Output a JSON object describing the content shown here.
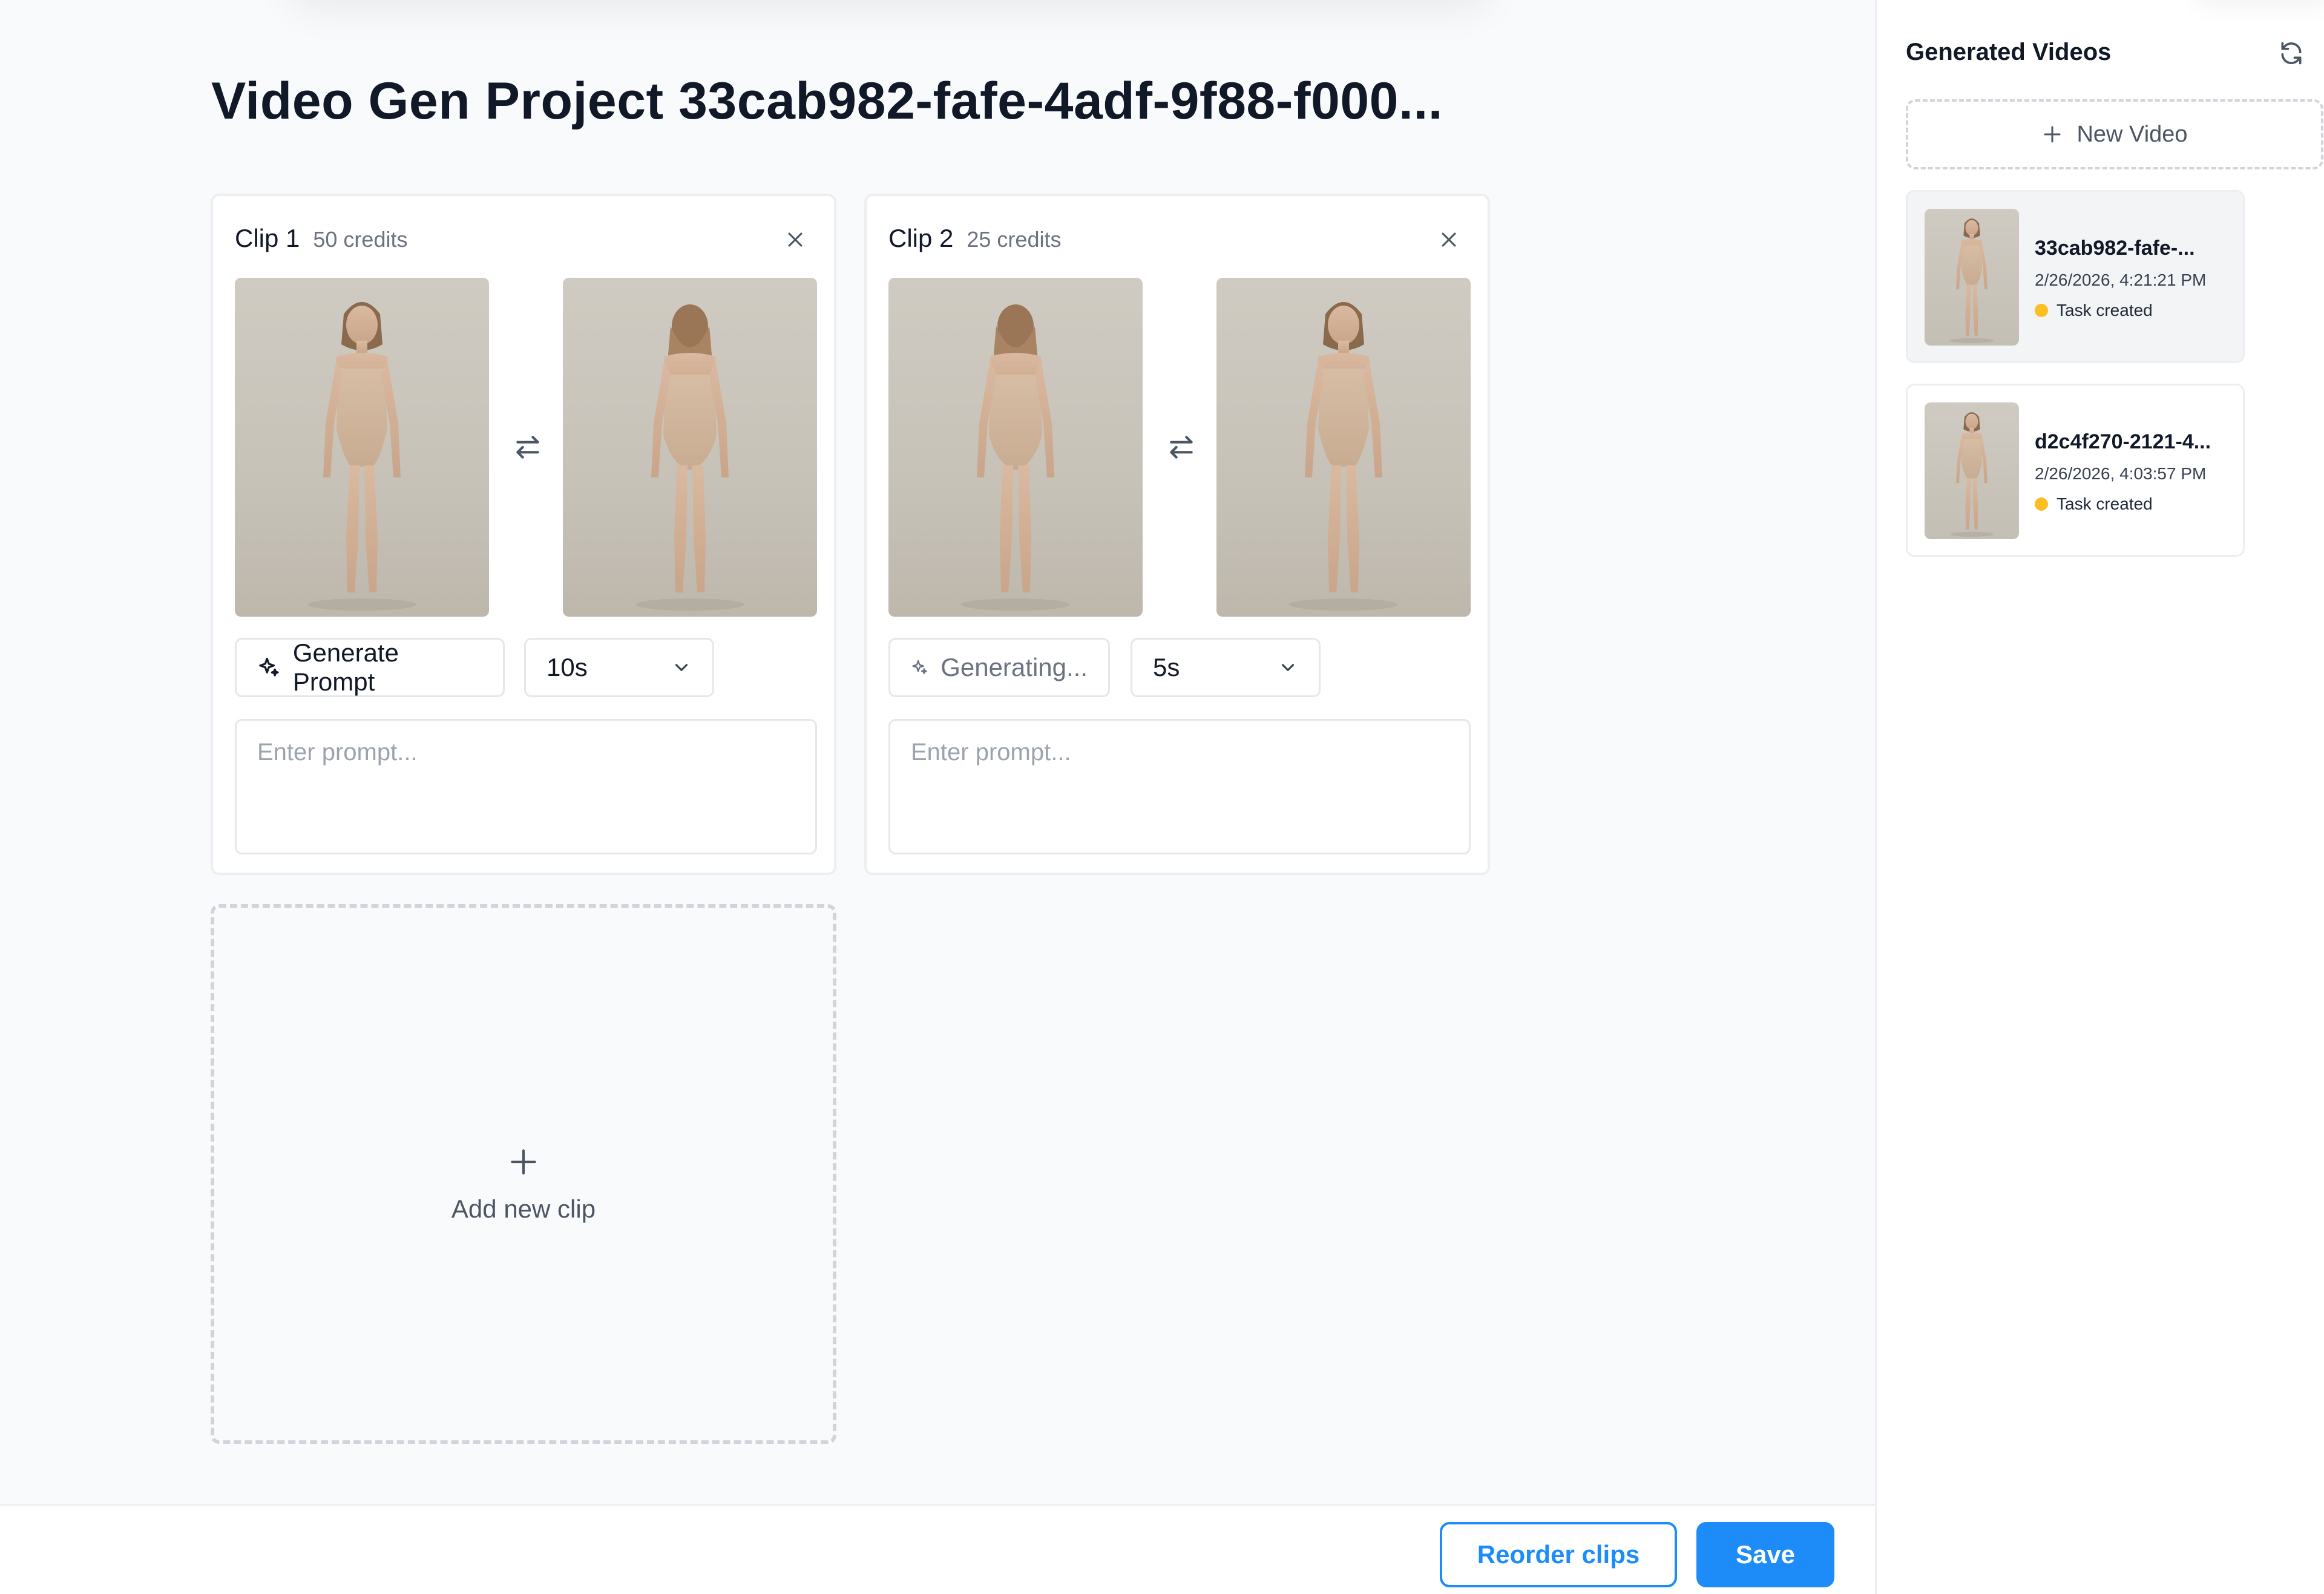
{
  "project": {
    "title": "Video Gen Project 33cab982-fafe-4adf-9f88-f000..."
  },
  "clips": [
    {
      "name": "Clip 1",
      "credits": "50 credits",
      "generate_label": "Generate Prompt",
      "duration": "10s",
      "prompt_placeholder": "Enter prompt...",
      "prompt_value": ""
    },
    {
      "name": "Clip 2",
      "credits": "25 credits",
      "generate_label": "Generating...",
      "duration": "5s",
      "prompt_placeholder": "Enter prompt...",
      "prompt_value": ""
    }
  ],
  "add_clip": {
    "label": "Add new clip"
  },
  "footer": {
    "reorder_label": "Reorder clips",
    "save_label": "Save"
  },
  "sidebar": {
    "title": "Generated Videos",
    "new_video_label": "New Video",
    "videos": [
      {
        "name": "33cab982-fafe-...",
        "date": "2/26/2026, 4:21:21 PM",
        "status": "Task created"
      },
      {
        "name": "d2c4f270-2121-4...",
        "date": "2/26/2026, 4:03:57 PM",
        "status": "Task created"
      }
    ]
  },
  "colors": {
    "accent": "#1d8cf8",
    "status_pending": "#fbbf24",
    "background": "#f9fafb"
  },
  "icons": {
    "close": "close-icon",
    "swap": "swap-arrows-icon",
    "sparkle": "sparkle-icon",
    "chevron": "chevron-down-icon",
    "plus": "plus-icon",
    "refresh": "refresh-icon"
  }
}
